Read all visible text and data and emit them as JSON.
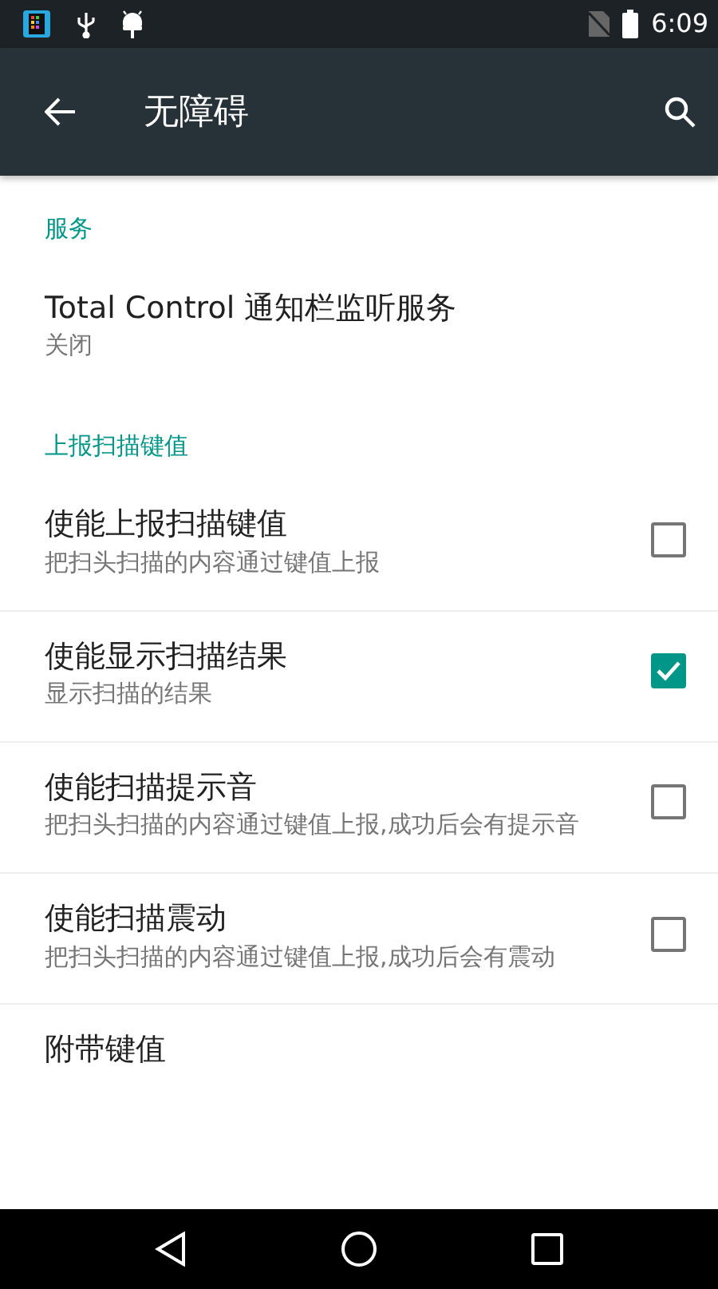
{
  "status_bar": {
    "time": "6:09"
  },
  "toolbar": {
    "title": "无障碍"
  },
  "sections": [
    {
      "header": "服务",
      "items": [
        {
          "kind": "plain",
          "title": "Total Control 通知栏监听服务",
          "summary": "关闭"
        }
      ]
    },
    {
      "header": "上报扫描键值",
      "items": [
        {
          "kind": "checkbox",
          "title": "使能上报扫描键值",
          "summary": "把扫头扫描的内容通过键值上报",
          "checked": false
        },
        {
          "kind": "checkbox",
          "title": "使能显示扫描结果",
          "summary": "显示扫描的结果",
          "checked": true
        },
        {
          "kind": "checkbox",
          "title": "使能扫描提示音",
          "summary": "把扫头扫描的内容通过键值上报,成功后会有提示音",
          "checked": false
        },
        {
          "kind": "checkbox",
          "title": "使能扫描震动",
          "summary": "把扫头扫描的内容通过键值上报,成功后会有震动",
          "checked": false
        },
        {
          "kind": "plain",
          "title": "附带键值"
        }
      ]
    }
  ]
}
